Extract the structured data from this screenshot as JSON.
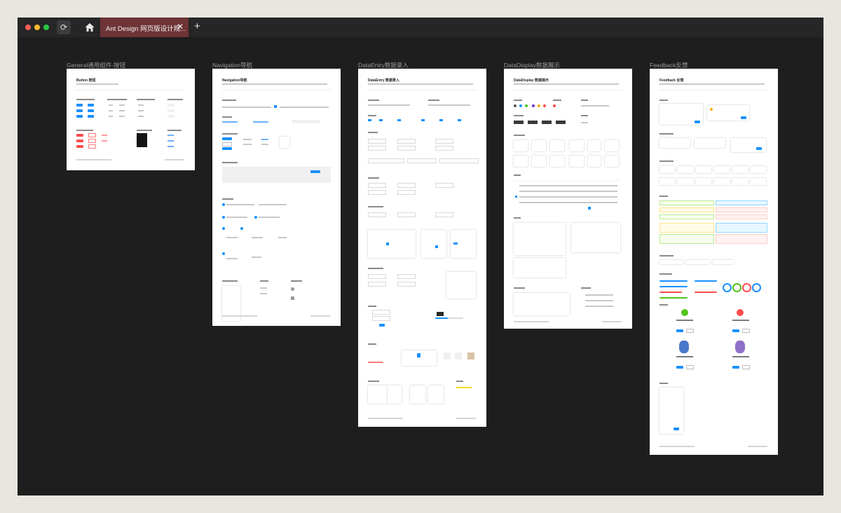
{
  "browser": {
    "tab_title": "Ant Design 网页版设计规...",
    "tab_close": "✕",
    "new_tab": "+",
    "reload_glyph": "⟳"
  },
  "frames": [
    {
      "title": "General通用组件-按钮",
      "heading": "Button 按钮"
    },
    {
      "title": "Navigation导航",
      "heading": "Navigation导航"
    },
    {
      "title": "DataEntry数据录入",
      "heading": "DataEntry 数据录入"
    },
    {
      "title": "DataDisplay数据展示",
      "heading": "DataDisplay 数据展示"
    },
    {
      "title": "Feedback反馈",
      "heading": "Feedback 反馈"
    }
  ],
  "colors": {
    "primary": "#1890ff",
    "danger": "#ff4d4f",
    "success": "#52c41a",
    "warning": "#faad14",
    "tab_active": "#6e3436",
    "canvas": "#1e1e1e"
  },
  "icons": [
    "close-light",
    "minimize-light",
    "zoom-light",
    "reload-icon",
    "home-icon",
    "tab-close-icon",
    "new-tab-icon"
  ]
}
